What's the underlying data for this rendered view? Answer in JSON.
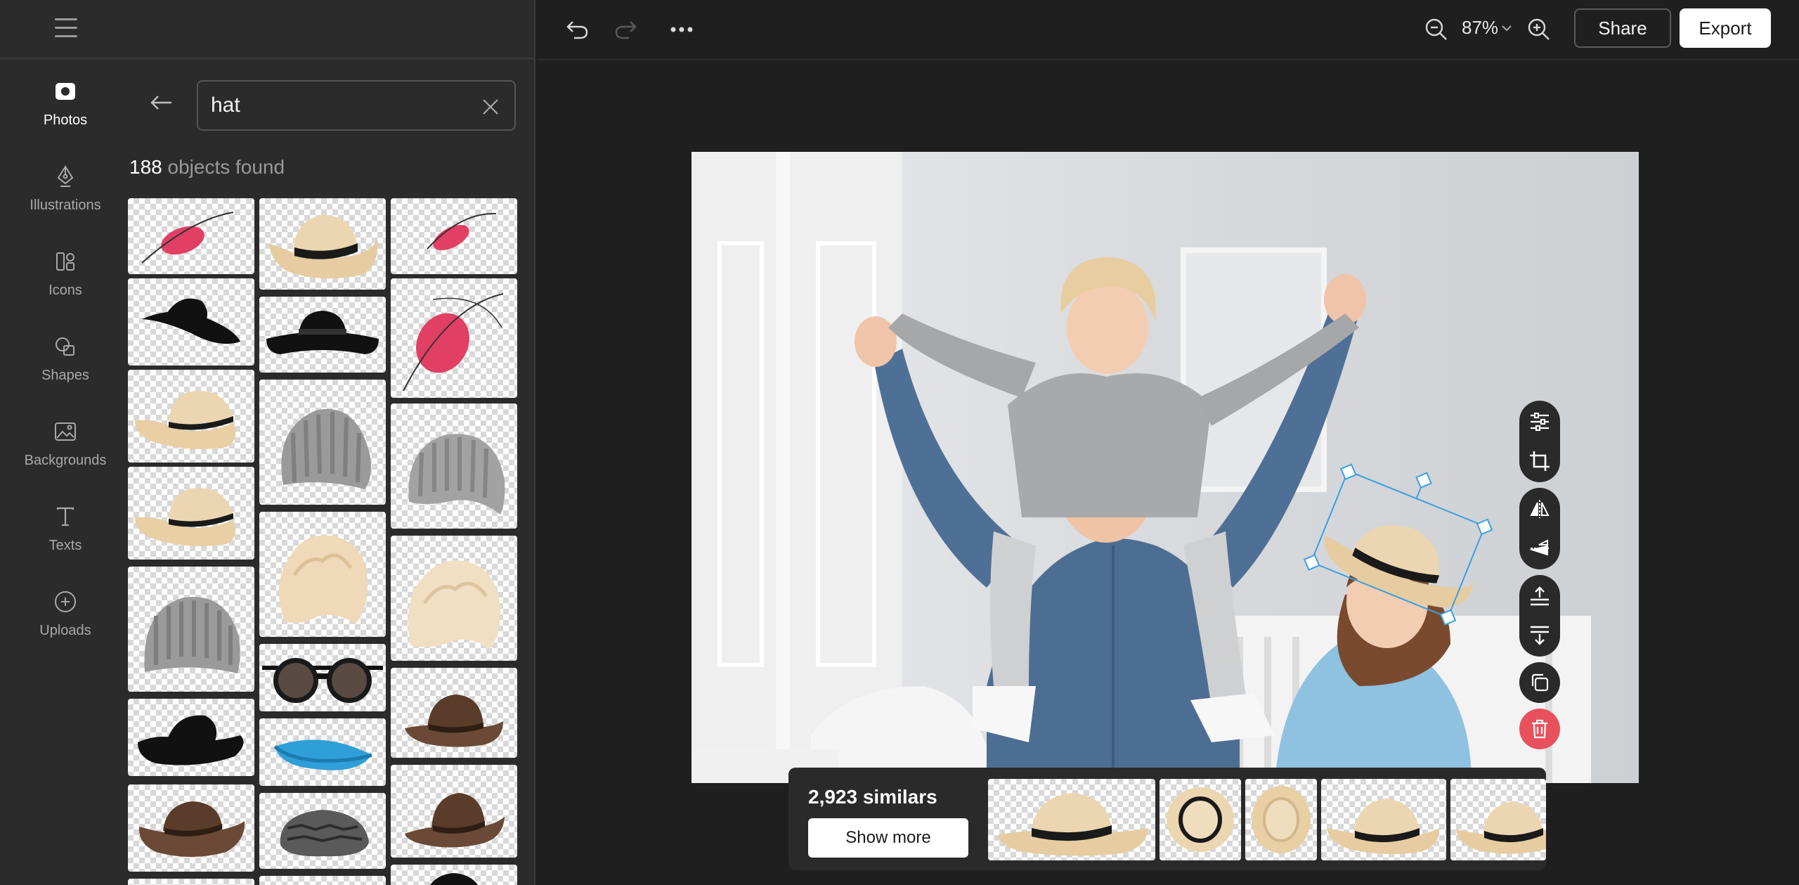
{
  "sidebar": {
    "items": [
      {
        "label": "Photos",
        "icon": "camera-icon",
        "active": true
      },
      {
        "label": "Illustrations",
        "icon": "pen-nib-icon",
        "active": false
      },
      {
        "label": "Icons",
        "icon": "icons-grid-icon",
        "active": false
      },
      {
        "label": "Shapes",
        "icon": "shapes-icon",
        "active": false
      },
      {
        "label": "Backgrounds",
        "icon": "image-icon",
        "active": false
      },
      {
        "label": "Texts",
        "icon": "text-t-icon",
        "active": false
      },
      {
        "label": "Uploads",
        "icon": "plus-circle-icon",
        "active": false
      }
    ]
  },
  "search": {
    "value": "hat",
    "placeholder": ""
  },
  "results": {
    "count": "188",
    "count_label": "objects found",
    "items": [
      "red fascinator hat",
      "straw fedora hat",
      "red fascinator hat",
      "black wide brim hat",
      "black wide brim hat",
      "red fascinator hat",
      "straw fedora hat",
      "grey knit beanie",
      "grey knit beanie",
      "straw fedora hat",
      "blonde curly wig",
      "blonde curly wig",
      "grey knit beanie",
      "round sunglasses",
      "brown fedora hat",
      "black wide brim hat",
      "blue sun visor",
      "brown fedora hat",
      "brown fedora hat",
      "tweed flat cap",
      "black hat"
    ]
  },
  "toolbar": {
    "zoom": "87%",
    "share_label": "Share",
    "export_label": "Export"
  },
  "tools": [
    "adjust-sliders-icon",
    "crop-icon",
    "flip-horizontal-icon",
    "flip-vertical-icon",
    "bring-forward-icon",
    "send-backward-icon",
    "duplicate-icon",
    "delete-icon"
  ],
  "similars": {
    "count_label": "2,923 similars",
    "show_more_label": "Show more"
  },
  "colors": {
    "accent_selection": "#3aa0e0",
    "delete_red": "#e8515c",
    "panel_bg": "#2b2b2b",
    "app_bg": "#1f1f1f"
  }
}
